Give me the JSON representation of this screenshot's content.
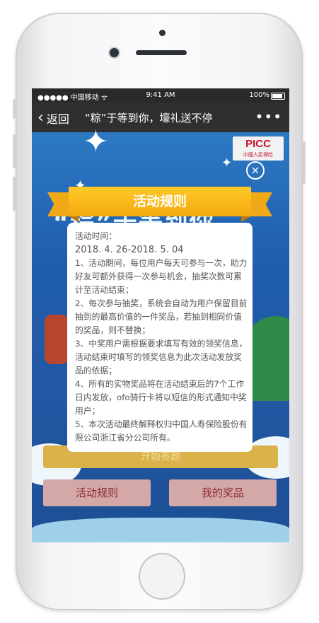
{
  "status_bar": {
    "carrier": "●●●●● 中国移动 ᯤ",
    "time": "9:41 AM",
    "battery": "100%"
  },
  "navbar": {
    "back_label": "返回",
    "title": "“粽”于等到你，壕礼送不停",
    "more": "•••"
  },
  "banner": {
    "headline": "“粽”于等到你",
    "brand_logo_text": "PICC",
    "brand_logo_sub": "中国人民保险"
  },
  "modal": {
    "title": "活动规则",
    "time_label": "活动时间：",
    "date_range": "2018. 4. 26-2018. 5. 04",
    "rules": [
      "1、活动期间，每位用户每天可参与一次，助力好友可额外获得一次参与机会，抽奖次数可累计至活动结束；",
      "2、每次参与抽奖，系统会自动为用户保留目前抽到的最高价值的一件奖品，若抽到相同价值的奖品，则不替换；",
      "3、中奖用户需根据要求填写有效的领奖信息，活动结束时填写的领奖信息为此次活动发放奖品的依据；",
      "4、所有的实物奖品将在活动结束后的7个工作日内发放，ofo骑行卡将以短信的形式通知中奖用户；",
      "5、本次活动最终解释权归中国人寿保险股份有限公司浙江省分公司所有。"
    ]
  },
  "buttons": {
    "start_label": "开始答题",
    "rules_label": "活动规则",
    "prizes_label": "我的奖品"
  },
  "colors": {
    "ribbon": "#f5b31a",
    "accent_red": "#8a2b2b",
    "nav_bg": "#2f2f2f"
  }
}
